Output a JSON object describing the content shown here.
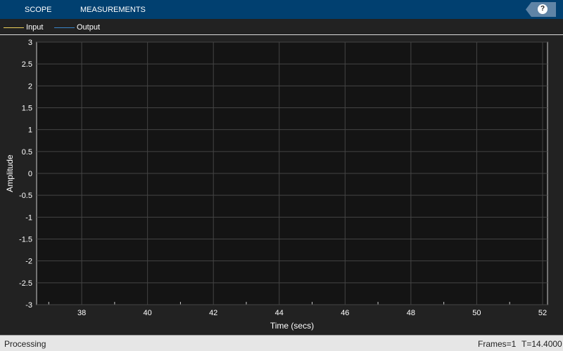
{
  "toolstrip": {
    "tabs": [
      "SCOPE",
      "MEASUREMENTS"
    ],
    "help_label": "?"
  },
  "legend": [
    {
      "label": "Input",
      "color": "#edd15a"
    },
    {
      "label": "Output",
      "color": "#3a86c8"
    }
  ],
  "chart_data": {
    "type": "line",
    "series": [
      {
        "name": "Input",
        "values": []
      },
      {
        "name": "Output",
        "values": []
      }
    ],
    "xlabel": "Time (secs)",
    "ylabel": "Amplitude",
    "xlim": [
      36.63,
      52.15
    ],
    "ylim": [
      -3,
      3
    ],
    "xticks": [
      38,
      40,
      42,
      44,
      46,
      48,
      50,
      52
    ],
    "yticks": [
      3,
      2.5,
      2,
      1.5,
      1,
      0.5,
      0,
      -0.5,
      -1,
      -1.5,
      -2,
      -2.5,
      -3
    ],
    "grid": true
  },
  "status": {
    "left": "Processing",
    "frames": "Frames=1",
    "time": "T=14.4000"
  }
}
